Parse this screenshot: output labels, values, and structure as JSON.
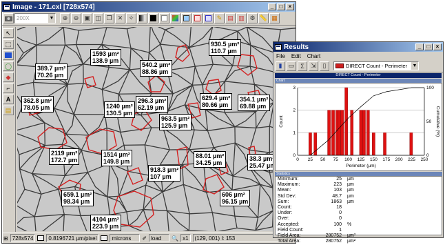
{
  "image_window": {
    "title": "Image - 171.cxl [728x574]",
    "zoom_value": "200X",
    "toolbar_icons": [
      "camera-icon",
      "zoom-in-icon",
      "zoom-out-icon",
      "fit-icon",
      "zoom-1-icon",
      "copy-icon",
      "grid-icon",
      "select-icon",
      "grayscale-icon",
      "black-icon",
      "white-icon",
      "palette-icon",
      "overlay-icon",
      "box-icon",
      "pencil-icon",
      "measure-icon",
      "count-icon",
      "settings-icon",
      "ruler-icon"
    ],
    "left_tools": [
      "pointer-icon",
      "select-rect-icon",
      "fill-blue-icon",
      "lasso-icon",
      "eraser-icon",
      "brush-icon",
      "text-icon",
      "calibrate-icon"
    ],
    "labels": [
      {
        "id": "l1",
        "area": "1593 µm²",
        "perim": "138.9 µm"
      },
      {
        "id": "l2",
        "area": "930.5 µm²",
        "perim": "110.7 µm"
      },
      {
        "id": "l3",
        "area": "389.7 µm²",
        "perim": "70.26 µm"
      },
      {
        "id": "l4",
        "area": "540.2 µm²",
        "perim": "88.86 µm"
      },
      {
        "id": "l5",
        "area": "362.8 µm²",
        "perim": "78.05 µm"
      },
      {
        "id": "l6",
        "area": "1240 µm²",
        "perim": "130.5 µm"
      },
      {
        "id": "l7",
        "area": "296.3 µm²",
        "perim": "62.19 µm"
      },
      {
        "id": "l8",
        "area": "629.4 µm²",
        "perim": "80.66 µm"
      },
      {
        "id": "l9",
        "area": "354.1 µm²",
        "perim": "69.88 µm"
      },
      {
        "id": "l10",
        "area": "963.5 µm²",
        "perim": "125.9 µm"
      },
      {
        "id": "l11",
        "area": "2119 µm²",
        "perim": "172.7 µm"
      },
      {
        "id": "l12",
        "area": "1514 µm²",
        "perim": "149.8 µm"
      },
      {
        "id": "l13",
        "area": "918.3 µm²",
        "perim": "107 µm"
      },
      {
        "id": "l14",
        "area": "88.01 µm²",
        "perim": "34.25 µm"
      },
      {
        "id": "l15",
        "area": "38.3 µm²",
        "perim": "25.47 µm"
      },
      {
        "id": "l16",
        "area": "659.1 µm²",
        "perim": "98.34 µm"
      },
      {
        "id": "l17",
        "area": "606 µm²",
        "perim": "96.15 µm"
      },
      {
        "id": "l18",
        "area": "4104 µm²",
        "perim": "223.9 µm"
      }
    ],
    "status": {
      "size": "728x574",
      "scale": "0.8196721 µm/pixel",
      "units": "microns",
      "load": "load",
      "zoom": "x1",
      "coords": "(129, 001) I: 153"
    }
  },
  "results_window": {
    "title": "Results",
    "menu": [
      "File",
      "Edit",
      "Chart"
    ],
    "selector_value": "DIRECT Count - Perimeter",
    "chart_caption": "DIRECT Count - Perimeter",
    "chart_panel_label": "Chart",
    "stats_panel_label": "Statistics",
    "statistics": [
      {
        "key": "Minimum:",
        "value": "25",
        "unit": "µm"
      },
      {
        "key": "Maximum:",
        "value": "223",
        "unit": "µm"
      },
      {
        "key": "Mean:",
        "value": "103",
        "unit": "µm"
      },
      {
        "key": "Std Dev:",
        "value": "48.7",
        "unit": "µm"
      },
      {
        "key": "Sum:",
        "value": "1863",
        "unit": "µm"
      },
      {
        "key": "Count:",
        "value": "18",
        "unit": ""
      },
      {
        "key": "Under:",
        "value": "0",
        "unit": ""
      },
      {
        "key": "Over:",
        "value": "0",
        "unit": ""
      },
      {
        "key": "Accepted:",
        "value": "100",
        "unit": "%"
      },
      {
        "key": "Field Count:",
        "value": "1",
        "unit": ""
      },
      {
        "key": "Field Area:",
        "value": "280752",
        "unit": "µm²"
      },
      {
        "key": "Total Area:",
        "value": "280752",
        "unit": "µm²"
      }
    ]
  },
  "chart_data": {
    "type": "bar",
    "title": "",
    "xlabel": "Perimeter (µm)",
    "ylabel": "Count",
    "y2label": "Cumulative (%)",
    "xlim": [
      0,
      250
    ],
    "ylim": [
      0,
      3
    ],
    "y2lim": [
      0,
      100
    ],
    "x_ticks": [
      0,
      25,
      50,
      75,
      100,
      125,
      150,
      175,
      200,
      225,
      250
    ],
    "y_ticks": [
      0,
      1,
      2,
      3
    ],
    "y2_ticks": [
      0,
      50,
      100
    ],
    "bar_color": "#dd1111",
    "bars": [
      {
        "x": 25,
        "value": 1
      },
      {
        "x": 35,
        "value": 1
      },
      {
        "x": 62,
        "value": 2
      },
      {
        "x": 70,
        "value": 2
      },
      {
        "x": 78,
        "value": 2
      },
      {
        "x": 82,
        "value": 2
      },
      {
        "x": 88,
        "value": 2
      },
      {
        "x": 96,
        "value": 3
      },
      {
        "x": 107,
        "value": 2
      },
      {
        "x": 125,
        "value": 2
      },
      {
        "x": 131,
        "value": 2
      },
      {
        "x": 139,
        "value": 2
      },
      {
        "x": 150,
        "value": 1
      },
      {
        "x": 172,
        "value": 1
      },
      {
        "x": 224,
        "value": 1
      }
    ],
    "cumulative": [
      [
        25,
        0
      ],
      [
        60,
        22
      ],
      [
        100,
        55
      ],
      [
        125,
        72
      ],
      [
        150,
        88
      ],
      [
        175,
        94
      ],
      [
        225,
        100
      ],
      [
        250,
        100
      ]
    ]
  }
}
